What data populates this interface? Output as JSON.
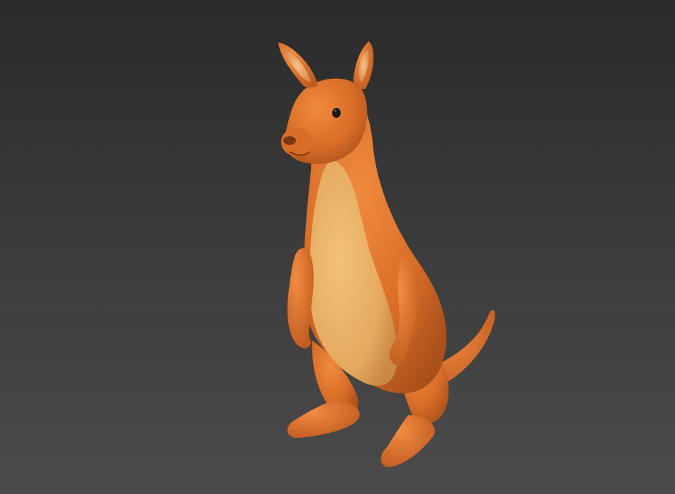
{
  "viewport": {
    "background_top": "#2a2a2a",
    "background_bottom": "#4b4b4b"
  },
  "model": {
    "subject": "kangaroo",
    "body_color": "#e07a32",
    "belly_color": "#edb56c",
    "eye_color": "#1a1a1a"
  }
}
